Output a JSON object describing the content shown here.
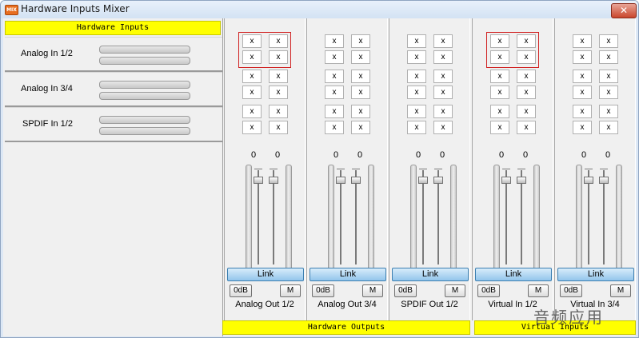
{
  "window": {
    "title": "Hardware Inputs Mixer",
    "icon_text": "MIX",
    "close_glyph": "✕"
  },
  "inputs": {
    "header": "Hardware Inputs",
    "rows": [
      {
        "label": "Analog In  1/2"
      },
      {
        "label": "Analog In  3/4"
      },
      {
        "label": "SPDIF In 1/2"
      }
    ]
  },
  "strips": [
    {
      "label": "Analog Out 1/2",
      "level_left": "0",
      "level_right": "0",
      "link": "Link",
      "odb": "0dB",
      "mute": "M",
      "highlighted_pair": 0
    },
    {
      "label": "Analog Out 3/4",
      "level_left": "0",
      "level_right": "0",
      "link": "Link",
      "odb": "0dB",
      "mute": "M",
      "highlighted_pair": -1
    },
    {
      "label": "SPDIF Out 1/2",
      "level_left": "0",
      "level_right": "0",
      "link": "Link",
      "odb": "0dB",
      "mute": "M",
      "highlighted_pair": -1
    },
    {
      "label": "Virtual In 1/2",
      "level_left": "0",
      "level_right": "0",
      "link": "Link",
      "odb": "0dB",
      "mute": "M",
      "highlighted_pair": 0
    },
    {
      "label": "Virtual In 3/4",
      "level_left": "0",
      "level_right": "0",
      "link": "Link",
      "odb": "0dB",
      "mute": "M",
      "highlighted_pair": -1
    }
  ],
  "matrix_cell": "x",
  "footer": {
    "hardware_outputs": "Hardware Outputs",
    "virtual_inputs": "Virtual Inputs"
  },
  "watermark": "音频应用",
  "colors": {
    "header_yellow": "#ffff00",
    "link_blue": "#93c5ec",
    "highlight_red": "#d02020"
  }
}
